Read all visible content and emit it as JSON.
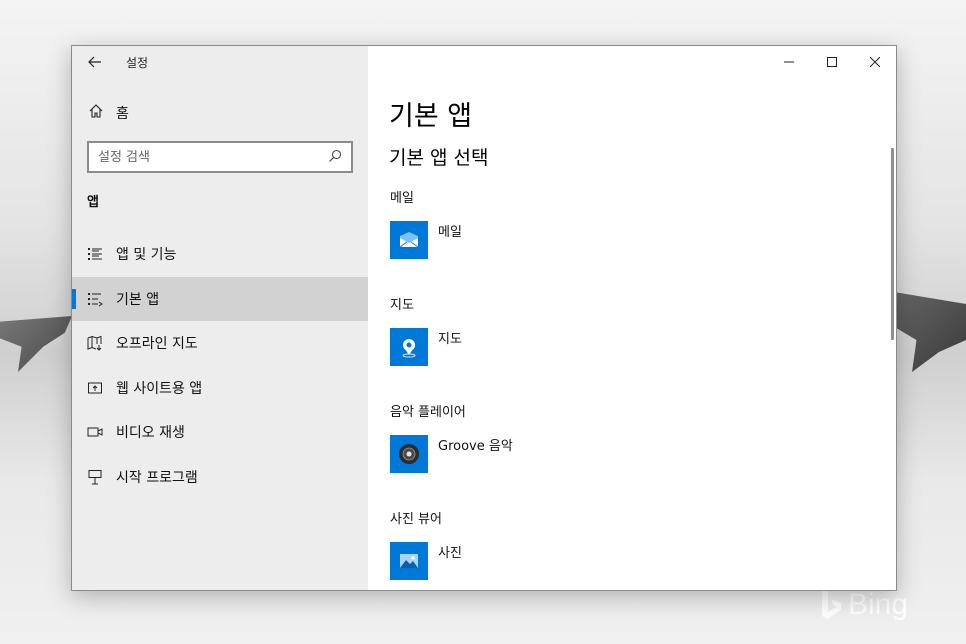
{
  "window": {
    "title": "설정",
    "home_label": "홈",
    "search_placeholder": "설정 검색",
    "section_heading": "앱"
  },
  "nav": [
    {
      "label": "앱 및 기능",
      "icon": "apps-features-icon",
      "active": false
    },
    {
      "label": "기본 앱",
      "icon": "default-apps-icon",
      "active": true
    },
    {
      "label": "오프라인 지도",
      "icon": "offline-maps-icon",
      "active": false
    },
    {
      "label": "웹 사이트용 앱",
      "icon": "apps-for-websites-icon",
      "active": false
    },
    {
      "label": "비디오 재생",
      "icon": "video-playback-icon",
      "active": false
    },
    {
      "label": "시작 프로그램",
      "icon": "startup-icon",
      "active": false
    }
  ],
  "content": {
    "page_title": "기본 앱",
    "sub_title": "기본 앱 선택",
    "categories": [
      {
        "category": "메일",
        "app": "메일",
        "icon": "mail-icon",
        "tile_color": "#0078d7"
      },
      {
        "category": "지도",
        "app": "지도",
        "icon": "maps-icon",
        "tile_color": "#0078d7"
      },
      {
        "category": "음악 플레이어",
        "app": "Groove 음악",
        "icon": "groove-music-icon",
        "tile_color": "#0078d7"
      },
      {
        "category": "사진 뷰어",
        "app": "사진",
        "icon": "photos-icon",
        "tile_color": "#0078d7"
      }
    ]
  },
  "colors": {
    "accent": "#0078d7",
    "sidebar_bg": "#ececec",
    "active_bg": "#cdcdcd"
  },
  "watermark": "Bing"
}
